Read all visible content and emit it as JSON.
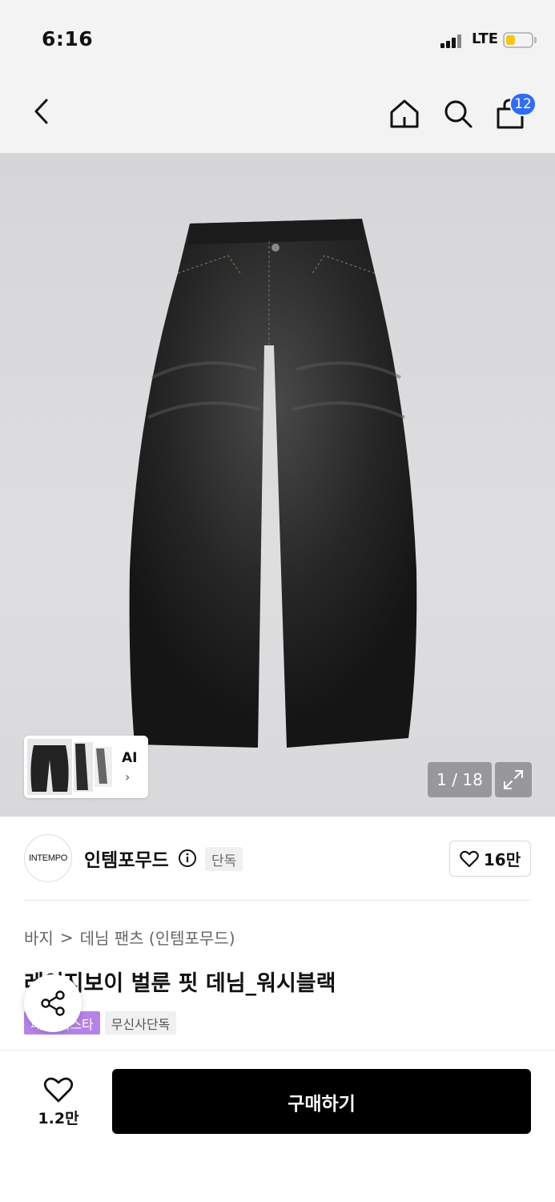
{
  "status_bar": {
    "time": "6:16",
    "network": "LTE"
  },
  "nav": {
    "cart_count": "12"
  },
  "gallery": {
    "counter": "1 / 18",
    "ai_label": "AI",
    "ai_chevron": "›"
  },
  "brand": {
    "logo_text": "INTEMPO",
    "name": "인템포무드",
    "exclusive_tag": "단독",
    "likes": "16만"
  },
  "product": {
    "breadcrumb": [
      "바지",
      "데님 팬츠 (인템포무드)"
    ],
    "breadcrumb_separator": ">",
    "title": "레이지보이 벌룬 핏 데님_워시블랙",
    "tags": [
      "패션 페스타",
      "무신사단독"
    ]
  },
  "bottom_bar": {
    "likes": "1.2만",
    "buy_label": "구매하기"
  },
  "colors": {
    "accent_badge": "#2f6df6",
    "tag_purple": "#b583e8",
    "buy_button": "#000000",
    "battery": "#f5c518"
  }
}
